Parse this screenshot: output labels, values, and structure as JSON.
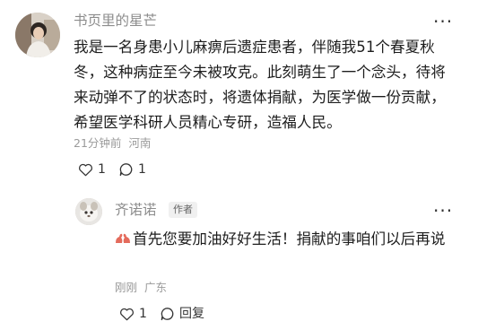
{
  "comment": {
    "username": "书页里的星芒",
    "text": "我是一名身患小儿麻痹后遗症患者，伴随我51个春夏秋冬，这种病症至今未被攻克。此刻萌生了一个念头，待将来动弹不了的状态时，将遗体捐献，为医学做一份贡献，希望医学科研人员精心专研，造福人民。",
    "time": "21分钟前",
    "location": "河南",
    "likes": "1",
    "replies": "1"
  },
  "reply": {
    "username": "齐诺诺",
    "badge": "作者",
    "text": "首先您要加油好好生活！捐献的事咱们以后再说",
    "emoji_icon": "flexed-biceps-icon",
    "time": "刚刚",
    "location": "广东",
    "likes": "1",
    "reply_label": "回复"
  },
  "icons": {
    "more": "more-options-icon",
    "like": "heart-outline-icon",
    "comment": "comment-bubble-icon"
  }
}
